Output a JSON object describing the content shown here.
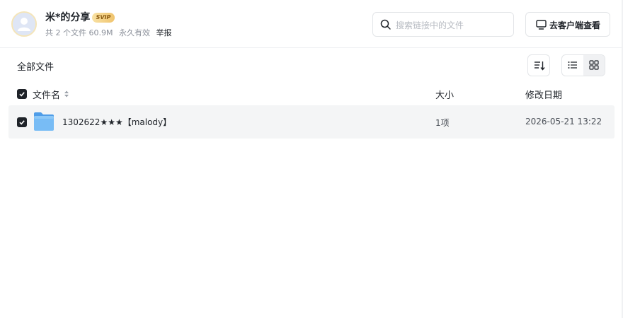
{
  "header": {
    "share_title": "米*的分享",
    "badge": "SVIP",
    "meta": {
      "file_count": "共 2 个文件 60.9M",
      "validity": "永久有效",
      "report_label": "举报"
    },
    "search": {
      "placeholder": "搜索链接中的文件"
    },
    "client_button_label": "去客户端查看"
  },
  "breadcrumb": {
    "label": "全部文件"
  },
  "view_mode": "grid",
  "table": {
    "columns": {
      "name": "文件名",
      "size": "大小",
      "date": "修改日期"
    },
    "rows": [
      {
        "name": "1302622★★★【malody】",
        "size": "1项",
        "date": "2026-05-21 13:22",
        "checked": true,
        "icon": "folder-icon"
      }
    ],
    "all_checked": true
  },
  "colors": {
    "accent": "#1f2329",
    "row_bg": "#f4f5f6",
    "folder": "#6db3f2",
    "badge": "#f0c46e"
  }
}
